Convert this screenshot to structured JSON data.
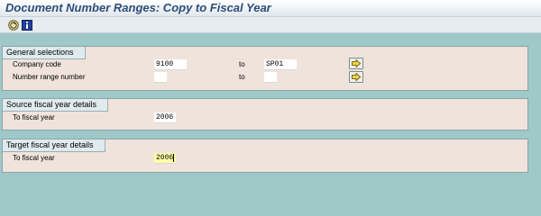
{
  "window": {
    "title": "Document Number Ranges: Copy to Fiscal Year"
  },
  "toolbar": {
    "execute_icon": "execute-icon",
    "info_icon": "information-icon"
  },
  "general_selections": {
    "header": "General selections",
    "company_code_label": "Company code",
    "company_code_from": "9100",
    "to_label_1": "to",
    "company_code_to": "SP01",
    "number_range_label": "Number range number",
    "number_range_from": "",
    "to_label_2": "to",
    "number_range_to": ""
  },
  "source": {
    "header": "Source fiscal year details",
    "to_fiscal_year_label": "To fiscal year",
    "to_fiscal_year_value": "2006"
  },
  "target": {
    "header": "Target fiscal year details",
    "to_fiscal_year_label": "To fiscal year",
    "to_fiscal_year_value": "2006"
  },
  "colors": {
    "background": "#9fc8c8",
    "group_background": "#efe3dc",
    "title_text": "#2d4d7a",
    "active_field": "#ffffa8"
  }
}
